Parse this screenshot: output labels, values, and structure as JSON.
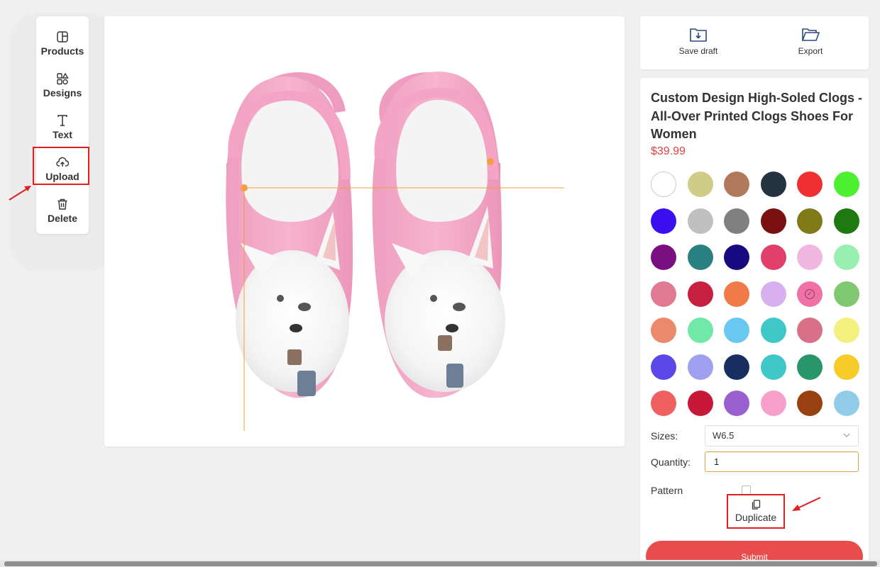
{
  "toolbar": {
    "products": "Products",
    "designs": "Designs",
    "text": "Text",
    "upload": "Upload",
    "delete": "Delete"
  },
  "actions": {
    "save_draft": "Save draft",
    "export": "Export"
  },
  "product": {
    "title": "Custom Design High-Soled Clogs - All-Over Printed Clogs Shoes For Women",
    "price": "$39.99"
  },
  "colors": [
    "#ffffff",
    "#cfcc88",
    "#b07a5a",
    "#253240",
    "#f03030",
    "#4cf030",
    "#3a10f0",
    "#c0c0c0",
    "#808080",
    "#7a1010",
    "#807a18",
    "#1e7a10",
    "#7a1080",
    "#2a8080",
    "#180a80",
    "#e0406a",
    "#f0b8e0",
    "#98f0b0",
    "#e07a90",
    "#c82040",
    "#f07a48",
    "#d8b0f0",
    "#f070a8",
    "#80c870",
    "#ea8a6a",
    "#70e8a8",
    "#68c8f0",
    "#40c8c8",
    "#d87088",
    "#f4f080",
    "#5a48e8",
    "#a0a0f0",
    "#182e60",
    "#40c8c8",
    "#28966a",
    "#f8cc28",
    "#f06060",
    "#c81838",
    "#9a60d0",
    "#f8a0cc",
    "#984010",
    "#90cce8"
  ],
  "selected_color": "#f070a8",
  "form": {
    "sizes_label": "Sizes:",
    "size_value": "W6.5",
    "quantity_label": "Quantity:",
    "quantity_value": "1",
    "pattern_label": "Pattern",
    "duplicate": "Duplicate",
    "submit": "Submit"
  }
}
